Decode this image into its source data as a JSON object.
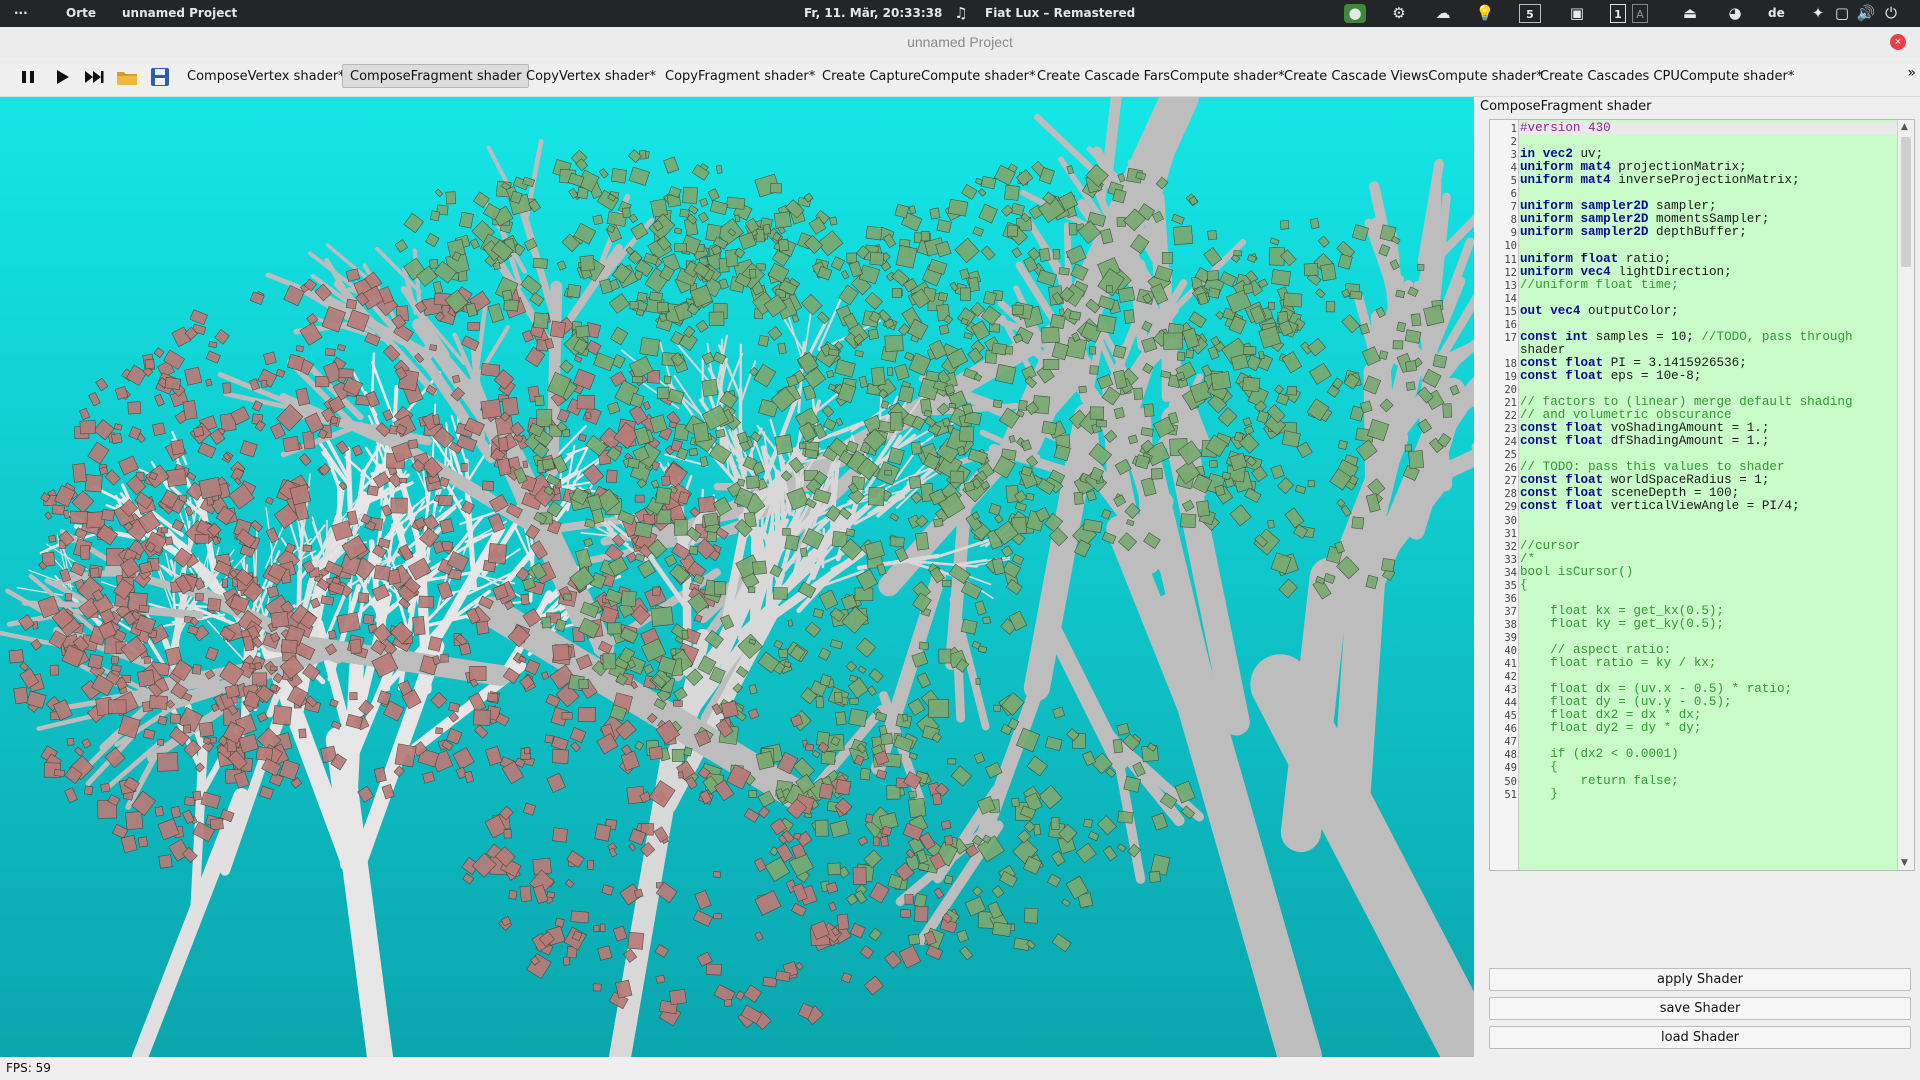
{
  "system_panel": {
    "menu_label": "···",
    "places_label": "Orte",
    "app_label": "unnamed Project",
    "datetime": "Fr, 11. Mär, 20:33:38",
    "now_playing": "Fiat Lux – Remastered",
    "workspace_number": "5",
    "keyboard_layout": "de",
    "indicator_1": "1",
    "indicator_a": "A"
  },
  "window": {
    "title": "unnamed Project",
    "close_glyph": "×"
  },
  "toolbar": {
    "tabs": [
      "ComposeVertex shader*",
      "ComposeFragment shader",
      "CopyVertex shader*",
      "CopyFragment shader*",
      "Create CaptureCompute shader*",
      "Create Cascade FarsCompute shader*",
      "Create Cascade ViewsCompute shader*",
      "Create Cascades CPUCompute shader*"
    ],
    "active_tab_index": 1,
    "overflow_glyph": "»"
  },
  "editor": {
    "title": "ComposeFragment shader",
    "lines": [
      {
        "n": "1",
        "t": "#version 430"
      },
      {
        "n": "2",
        "t": ""
      },
      {
        "n": "3",
        "t": "in vec2 uv;"
      },
      {
        "n": "4",
        "t": "uniform mat4 projectionMatrix;"
      },
      {
        "n": "5",
        "t": "uniform mat4 inverseProjectionMatrix;"
      },
      {
        "n": "6",
        "t": ""
      },
      {
        "n": "7",
        "t": "uniform sampler2D sampler;"
      },
      {
        "n": "8",
        "t": "uniform sampler2D momentsSampler;"
      },
      {
        "n": "9",
        "t": "uniform sampler2D depthBuffer;"
      },
      {
        "n": "10",
        "t": ""
      },
      {
        "n": "11",
        "t": "uniform float ratio;"
      },
      {
        "n": "12",
        "t": "uniform vec4 lightDirection;"
      },
      {
        "n": "13",
        "t": "//uniform float time;"
      },
      {
        "n": "14",
        "t": ""
      },
      {
        "n": "15",
        "t": "out vec4 outputColor;"
      },
      {
        "n": "16",
        "t": ""
      },
      {
        "n": "17",
        "t": "const int samples = 10; //TODO, pass through"
      },
      {
        "n": "",
        "t": "shader"
      },
      {
        "n": "18",
        "t": "const float PI = 3.1415926536;"
      },
      {
        "n": "19",
        "t": "const float eps = 10e-8;"
      },
      {
        "n": "20",
        "t": ""
      },
      {
        "n": "21",
        "t": "// factors to (linear) merge default shading"
      },
      {
        "n": "22",
        "t": "// and volumetric obscurance"
      },
      {
        "n": "23",
        "t": "const float voShadingAmount = 1.;"
      },
      {
        "n": "24",
        "t": "const float dfShadingAmount = 1.;"
      },
      {
        "n": "25",
        "t": ""
      },
      {
        "n": "26",
        "t": "// TODO: pass this values to shader"
      },
      {
        "n": "27",
        "t": "const float worldSpaceRadius = 1;"
      },
      {
        "n": "28",
        "t": "const float sceneDepth = 100;"
      },
      {
        "n": "29",
        "t": "const float verticalViewAngle = PI/4;"
      },
      {
        "n": "30",
        "t": ""
      },
      {
        "n": "31",
        "t": ""
      },
      {
        "n": "32",
        "t": "//cursor"
      },
      {
        "n": "33",
        "t": "/*"
      },
      {
        "n": "34",
        "t": "bool isCursor()"
      },
      {
        "n": "35",
        "t": "{"
      },
      {
        "n": "36",
        "t": ""
      },
      {
        "n": "37",
        "t": "    float kx = get_kx(0.5);"
      },
      {
        "n": "38",
        "t": "    float ky = get_ky(0.5);"
      },
      {
        "n": "39",
        "t": ""
      },
      {
        "n": "40",
        "t": "    // aspect ratio:"
      },
      {
        "n": "41",
        "t": "    float ratio = ky / kx;"
      },
      {
        "n": "42",
        "t": ""
      },
      {
        "n": "43",
        "t": "    float dx = (uv.x - 0.5) * ratio;"
      },
      {
        "n": "44",
        "t": "    float dy = (uv.y - 0.5);"
      },
      {
        "n": "45",
        "t": "    float dx2 = dx * dx;"
      },
      {
        "n": "46",
        "t": "    float dy2 = dy * dy;"
      },
      {
        "n": "47",
        "t": ""
      },
      {
        "n": "48",
        "t": "    if (dx2 < 0.0001)"
      },
      {
        "n": "49",
        "t": "    {"
      },
      {
        "n": "50",
        "t": "        return false;"
      },
      {
        "n": "51",
        "t": "    }"
      }
    ]
  },
  "buttons": {
    "apply": "apply Shader",
    "save": "save Shader",
    "load": "load Shader"
  },
  "status": {
    "fps": "FPS: 59"
  },
  "colors": {
    "sky_top": "#14e6e6",
    "sky_bottom": "#0aa6ae",
    "branch": "#bdbdbd",
    "leaf_green": "#7aaa72",
    "leaf_pink": "#b97b78",
    "editor_bg": "#c8fbc8"
  }
}
